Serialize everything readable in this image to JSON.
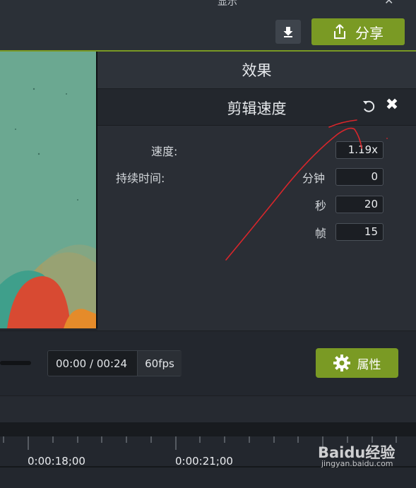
{
  "topbar": {
    "partial_label": "显示",
    "share_label": "分享"
  },
  "effects": {
    "header": "效果",
    "speed_panel": {
      "title": "剪辑速度",
      "speed_label": "速度:",
      "speed_value": "1.19x",
      "duration_label": "持续时间:",
      "minutes_label": "分钟",
      "minutes_value": "0",
      "seconds_label": "秒",
      "seconds_value": "20",
      "frames_label": "帧",
      "frames_value": "15"
    }
  },
  "playback": {
    "current_time": "00:00",
    "separator": "/",
    "total_time": "00:24",
    "fps": "60fps",
    "properties_label": "属性"
  },
  "timeline": {
    "timecodes": [
      "0:00:18;00",
      "0:00:21;00"
    ]
  },
  "watermark": {
    "logo": "Baidu经验",
    "url": "jingyan.baidu.com"
  },
  "colors": {
    "accent": "#7a9a24",
    "annotation": "#d9262b"
  }
}
